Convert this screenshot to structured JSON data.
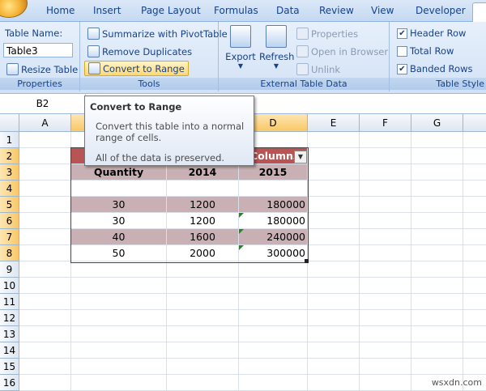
{
  "ribbon_tabs": [
    "Home",
    "Insert",
    "Page Layout",
    "Formulas",
    "Data",
    "Review",
    "View",
    "Developer"
  ],
  "properties": {
    "table_name_label": "Table Name:",
    "table_name_value": "Table3",
    "resize_label": "Resize Table",
    "group_label": "Properties"
  },
  "tools": {
    "summarize_label": "Summarize with PivotTable",
    "remove_dup_label": "Remove Duplicates",
    "convert_label": "Convert to Range",
    "group_label": "Tools"
  },
  "external": {
    "export_label": "Export",
    "refresh_label": "Refresh",
    "properties_label": "Properties",
    "open_browser_label": "Open in Browser",
    "unlink_label": "Unlink",
    "group_label": "External Table Data"
  },
  "style_options": {
    "header_row_label": "Header Row",
    "total_row_label": "Total Row",
    "banded_rows_label": "Banded Rows",
    "group_label": "Table Style",
    "header_row_checked": "✔",
    "total_row_checked": "",
    "banded_rows_checked": "✔"
  },
  "formula_bar": {
    "name_box": "B2"
  },
  "columns": [
    "A",
    "B",
    "C",
    "D",
    "E",
    "F",
    "G"
  ],
  "rows": [
    "1",
    "2",
    "3",
    "4",
    "5",
    "6",
    "7",
    "8",
    "9",
    "10",
    "11",
    "12",
    "13",
    "14",
    "15",
    "16"
  ],
  "table": {
    "header_visible": "Column3",
    "subheaders": [
      "Quantity",
      "2014",
      "2015"
    ],
    "data": [
      [
        "30",
        "1200",
        "180000"
      ],
      [
        "30",
        "1200",
        "180000"
      ],
      [
        "40",
        "1600",
        "240000"
      ],
      [
        "50",
        "2000",
        "300000"
      ]
    ]
  },
  "tooltip": {
    "title": "Convert to Range",
    "body": "Convert this table into a normal range of cells.",
    "note": "All of the data is preserved."
  },
  "watermark": "wsxdn.com",
  "colors": {
    "header_fill": "#b85454",
    "band_fill": "#c8b0b4",
    "selected_header": "#f9c866"
  }
}
